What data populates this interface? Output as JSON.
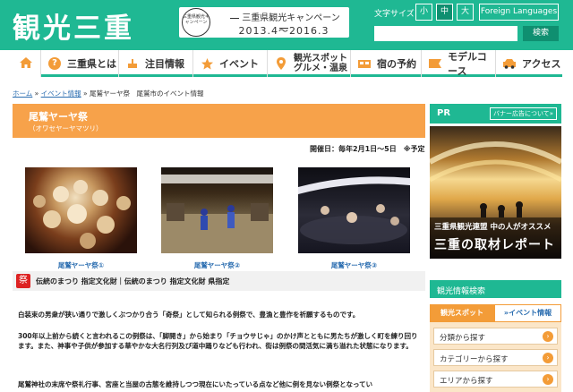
{
  "header": {
    "logo": "観光三重",
    "campaign_seal": "三重県観光キャンペーン",
    "campaign_title": "三重県観光キャンペーン",
    "campaign_period": "2013.4～2016.3",
    "font_size_label": "文字サイズ",
    "font_sizes": [
      "小",
      "中",
      "大"
    ],
    "foreign_languages": "Foreign Languages",
    "search_placeholder": "",
    "search_button": "検索"
  },
  "nav": {
    "items": [
      "三重県とは",
      "注目情報",
      "イベント",
      "観光スポット",
      "グルメ・温泉",
      "宿の予約",
      "モデルコース",
      "アクセス"
    ]
  },
  "breadcrumb": {
    "home": "ホーム",
    "sep": " » ",
    "events": "イベント情報",
    "current": "尾鷲ヤーヤ祭　尾鷲市のイベント情報"
  },
  "event": {
    "title": "尾鷲ヤーヤ祭",
    "kana": "（オワセヤーヤマツリ）",
    "date": "開催日：毎年2月1日～5日　※予定",
    "photo_captions": [
      "尾鷲ヤーヤ祭①",
      "尾鷲ヤーヤ祭②",
      "尾鷲ヤーヤ祭③"
    ],
    "tags": "伝統のまつり 指定文化財｜伝統のまつり 指定文化財 県指定",
    "paragraphs": [
      "白装束の男衆が狭い通りで激しくぶつかり合う「奇祭」として知られる例祭で、豊漁と豊作を祈願するものです。",
      "300年以上前から続くと言われるこの例祭は、「脚開き」から始まり「チョウサじゃ」のかけ声とともに男たちが激しく町を練り回ります。また、神事や子供が参加する華やかな大名行列及び道中踊りなども行われ、街は例祭の間活気に満ち溢れた状態になります。",
      "尾鷲神社の末席や祭礼行事、宮座と当屋の古態を維持しつつ現在にいたっている点など他に例を見ない例祭となってい"
    ]
  },
  "sidebar": {
    "pr_label": "PR",
    "pr_button": "バナー広告について»",
    "banner_line1": "三重県観光連盟 中の人がオススメ",
    "banner_line2": "三重の取材レポート",
    "search_title": "観光情報検索",
    "tab_spot": "観光スポット",
    "tab_event": "»イベント情報",
    "search_items": [
      "分類から探す",
      "カテゴリーから探す",
      "エリアから探す"
    ]
  },
  "colors": {
    "brand_green": "#1fb893",
    "accent_orange": "#f39c38",
    "title_orange": "#f7a24a",
    "link_blue": "#2a6db0"
  }
}
